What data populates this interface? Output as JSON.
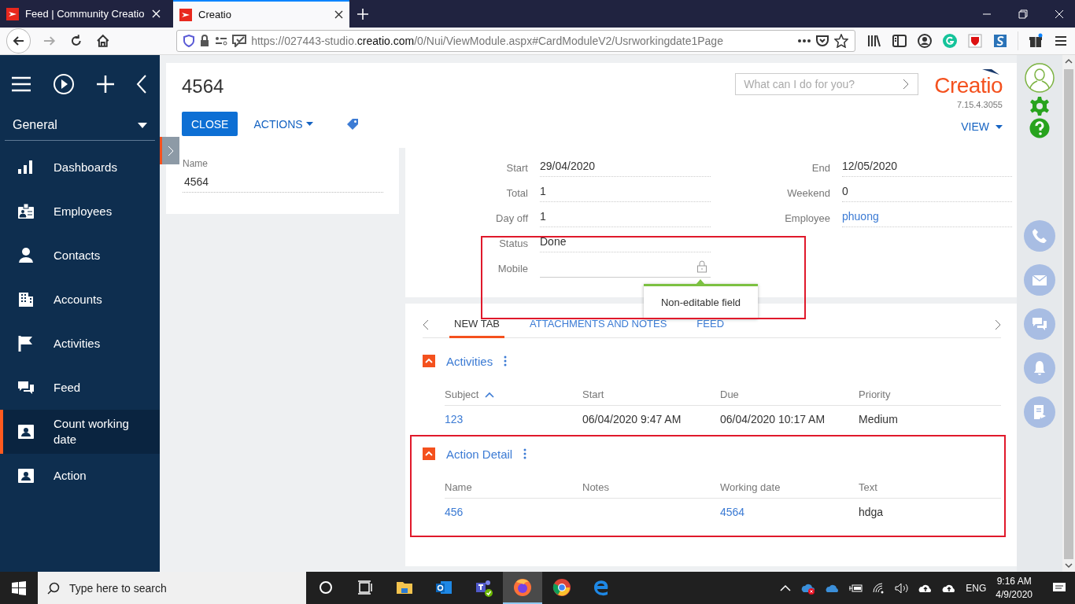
{
  "browser": {
    "tabs": [
      {
        "title": "Feed | Community Creatio",
        "selected": false
      },
      {
        "title": "Creatio",
        "selected": true
      }
    ],
    "url": {
      "prefix": "https://027443-studio.",
      "domain": "creatio.com",
      "path": "/0/Nui/ViewModule.aspx#CardModuleV2/Usrworkingdate1Page"
    }
  },
  "sidebar": {
    "section": "General",
    "items": [
      {
        "label": "Dashboards",
        "selected": false
      },
      {
        "label": "Employees",
        "selected": false
      },
      {
        "label": "Contacts",
        "selected": false
      },
      {
        "label": "Accounts",
        "selected": false
      },
      {
        "label": "Activities",
        "selected": false
      },
      {
        "label": "Feed",
        "selected": false
      },
      {
        "label": "Count working date",
        "selected": true
      },
      {
        "label": "Action",
        "selected": false
      }
    ]
  },
  "header": {
    "title": "4564",
    "buttons": [
      {
        "label": "CLOSE",
        "kind": "primary"
      },
      {
        "label": "ACTIONS",
        "kind": "menu"
      }
    ],
    "search": {
      "placeholder": "What can I do for you?"
    },
    "logo": "Creatio",
    "version": "7.15.4.3055",
    "view": "VIEW"
  },
  "name_card": {
    "label": "Name",
    "value": "4564"
  },
  "fields_card": {
    "highlighted": true,
    "tooltip": "Non-editable field",
    "left": [
      {
        "label": "Start",
        "value": "29/04/2020",
        "kind": "text"
      },
      {
        "label": "Total",
        "value": "1",
        "kind": "text"
      },
      {
        "label": "Day off",
        "value": "1",
        "kind": "text"
      },
      {
        "label": "Status",
        "value": "Done",
        "kind": "text"
      },
      {
        "label": "Mobile",
        "kind": "locked"
      }
    ],
    "right": [
      {
        "label": "End",
        "value": "12/05/2020",
        "kind": "text"
      },
      {
        "label": "Weekend",
        "value": "0",
        "kind": "text"
      },
      {
        "label": "Employee",
        "value": "phuong",
        "kind": "link"
      }
    ]
  },
  "tabs": [
    {
      "label": "NEW TAB",
      "selected": true
    },
    {
      "label": "ATTACHMENTS AND NOTES",
      "selected": false
    },
    {
      "label": "FEED",
      "selected": false
    }
  ],
  "details": [
    {
      "title": "Activities",
      "highlighted": false,
      "columns": [
        {
          "label": "Subject",
          "sorted": true
        },
        {
          "label": "Start",
          "sorted": false
        },
        {
          "label": "Due",
          "sorted": false
        },
        {
          "label": "Priority",
          "sorted": false
        }
      ],
      "rows": [
        [
          {
            "text": "123",
            "link": true
          },
          {
            "text": "06/04/2020 9:47 AM",
            "link": false
          },
          {
            "text": "06/04/2020 10:17 AM",
            "link": false
          },
          {
            "text": "Medium",
            "link": false
          }
        ]
      ]
    },
    {
      "title": "Action Detail",
      "highlighted": true,
      "columns": [
        {
          "label": "Name",
          "sorted": false
        },
        {
          "label": "Notes",
          "sorted": false
        },
        {
          "label": "Working date",
          "sorted": false
        },
        {
          "label": "Text",
          "sorted": false
        }
      ],
      "rows": [
        [
          {
            "text": "456",
            "link": true
          },
          null,
          {
            "text": "4564",
            "link": true
          },
          {
            "text": "hdga",
            "link": false
          }
        ]
      ]
    }
  ],
  "taskbar": {
    "search_placeholder": "Type here to search",
    "language": "ENG",
    "time": "9:16 AM",
    "date": "4/9/2020"
  }
}
